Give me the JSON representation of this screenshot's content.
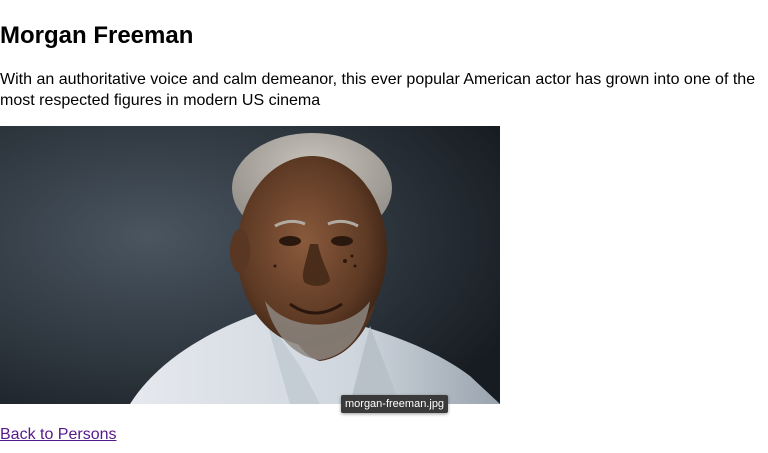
{
  "person": {
    "name": "Morgan Freeman",
    "description": "With an authoritative voice and calm demeanor, this ever popular American actor has grown into one of the most respected figures in modern US cinema",
    "image_icon": "portrait-photo",
    "image_tooltip": "morgan-freeman.jpg"
  },
  "nav": {
    "back_label": "Back to Persons"
  },
  "colors": {
    "link_visited": "#551a8b",
    "tooltip_bg": "#3a3a3a"
  }
}
